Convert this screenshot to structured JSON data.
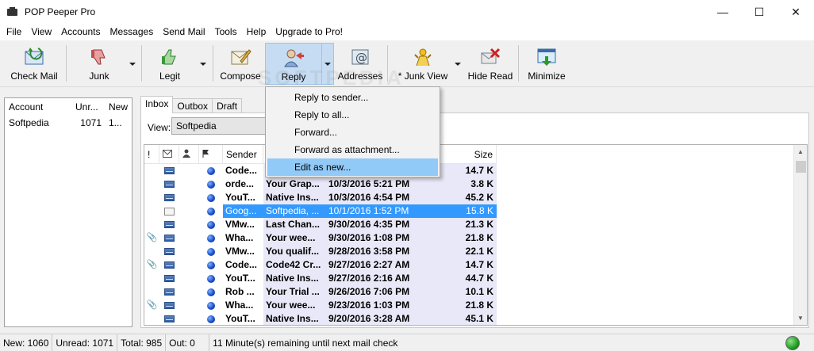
{
  "window": {
    "title": "POP Peeper Pro",
    "controls": {
      "minimize": "—",
      "maximize": "☐",
      "close": "✕"
    }
  },
  "menubar": [
    "File",
    "View",
    "Accounts",
    "Messages",
    "Send Mail",
    "Tools",
    "Help",
    "Upgrade to Pro!"
  ],
  "toolbar": {
    "check_mail": "Check Mail",
    "junk": "Junk",
    "legit": "Legit",
    "compose": "Compose",
    "reply": "Reply",
    "addresses": "Addresses",
    "junk_view": "* Junk View",
    "hide_read": "Hide Read",
    "minimize": "Minimize"
  },
  "accounts": {
    "headers": [
      "Account",
      "Unr...",
      "New"
    ],
    "rows": [
      {
        "account": "Softpedia",
        "unread": "1071",
        "new": "1..."
      }
    ]
  },
  "tabs": [
    "Inbox",
    "Outbox",
    "Draft"
  ],
  "view": {
    "label": "View:",
    "selected": "Softpedia"
  },
  "mail_list": {
    "headers": {
      "attach": "!",
      "sender": "Sender",
      "size": "Size"
    },
    "rows": [
      {
        "attach": false,
        "sender": "Code...",
        "subject": "",
        "date": "",
        "size": "14.7 K",
        "read": false,
        "selected": false
      },
      {
        "attach": false,
        "sender": "orde...",
        "subject": "Your Grap...",
        "date": "10/3/2016 5:21 PM",
        "size": "3.8 K",
        "read": false,
        "selected": false
      },
      {
        "attach": false,
        "sender": "YouT...",
        "subject": "Native Ins...",
        "date": "10/3/2016 4:54 PM",
        "size": "45.2 K",
        "read": false,
        "selected": false
      },
      {
        "attach": false,
        "sender": "Goog...",
        "subject": "Softpedia, ...",
        "date": "10/1/2016 1:52 PM",
        "size": "15.8 K",
        "read": true,
        "selected": true
      },
      {
        "attach": false,
        "sender": "VMw...",
        "subject": "Last Chan...",
        "date": "9/30/2016 4:35 PM",
        "size": "21.3 K",
        "read": false,
        "selected": false
      },
      {
        "attach": true,
        "sender": "Wha...",
        "subject": "Your wee...",
        "date": "9/30/2016 1:08 PM",
        "size": "21.8 K",
        "read": false,
        "selected": false
      },
      {
        "attach": false,
        "sender": "VMw...",
        "subject": "You qualif...",
        "date": "9/28/2016 3:58 PM",
        "size": "22.1 K",
        "read": false,
        "selected": false
      },
      {
        "attach": true,
        "sender": "Code...",
        "subject": "Code42 Cr...",
        "date": "9/27/2016 2:27 AM",
        "size": "14.7 K",
        "read": false,
        "selected": false
      },
      {
        "attach": false,
        "sender": "YouT...",
        "subject": "Native Ins...",
        "date": "9/27/2016 2:16 AM",
        "size": "44.7 K",
        "read": false,
        "selected": false
      },
      {
        "attach": false,
        "sender": "Rob ...",
        "subject": "Your Trial ...",
        "date": "9/26/2016 7:06 PM",
        "size": "10.1 K",
        "read": false,
        "selected": false
      },
      {
        "attach": true,
        "sender": "Wha...",
        "subject": "Your wee...",
        "date": "9/23/2016 1:03 PM",
        "size": "21.8 K",
        "read": false,
        "selected": false
      },
      {
        "attach": false,
        "sender": "YouT...",
        "subject": "Native Ins...",
        "date": "9/20/2016 3:28 AM",
        "size": "45.1 K",
        "read": false,
        "selected": false
      }
    ]
  },
  "reply_menu": {
    "items": [
      "Reply to sender...",
      "Reply to all...",
      "Forward...",
      "Forward as attachment...",
      "Edit as new..."
    ],
    "highlighted": 4
  },
  "statusbar": {
    "new": "New: 1060",
    "unread": "Unread: 1071",
    "total": "Total: 985",
    "out": "Out: 0",
    "message": "11 Minute(s) remaining until next mail check"
  },
  "watermark": "SOFTPEDIA",
  "colors": {
    "selection": "#3399ff",
    "menu_highlight": "#91c9f7",
    "toolbar_active": "#c6dcf2",
    "unread_cells": "#e8e8f8"
  }
}
